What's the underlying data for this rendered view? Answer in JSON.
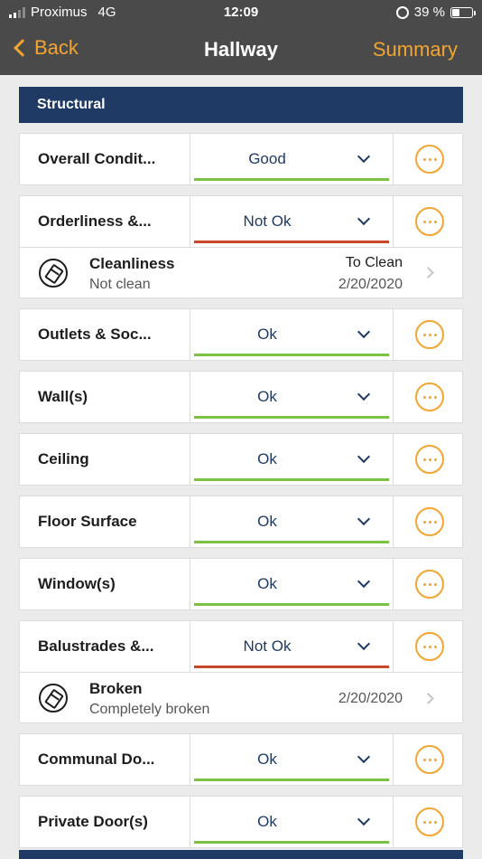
{
  "status_bar": {
    "carrier": "Proximus",
    "network": "4G",
    "time": "12:09",
    "battery": "39 %",
    "battery_level": 0.39
  },
  "nav": {
    "back_label": "Back",
    "title": "Hallway",
    "summary_label": "Summary"
  },
  "colors": {
    "accent": "#f2a531",
    "navy": "#1f3a64",
    "ok_line": "#7bc144",
    "not_ok_line": "#c9482a"
  },
  "section": {
    "title": "Structural"
  },
  "items": [
    {
      "label": "Overall Condit...",
      "value": "Good",
      "status": "ok"
    },
    {
      "label": "Orderliness &...",
      "value": "Not Ok",
      "status": "bad",
      "sub": {
        "name": "Cleanliness",
        "desc": "Not clean",
        "action": "To Clean",
        "date": "2/20/2020"
      }
    },
    {
      "label": "Outlets & Soc...",
      "value": "Ok",
      "status": "ok"
    },
    {
      "label": "Wall(s)",
      "value": "Ok",
      "status": "ok"
    },
    {
      "label": "Ceiling",
      "value": "Ok",
      "status": "ok"
    },
    {
      "label": "Floor Surface",
      "value": "Ok",
      "status": "ok"
    },
    {
      "label": "Window(s)",
      "value": "Ok",
      "status": "ok"
    },
    {
      "label": "Balustrades &...",
      "value": "Not Ok",
      "status": "bad",
      "sub": {
        "name": "Broken",
        "desc": "Completely broken",
        "action": "",
        "date": "2/20/2020"
      }
    },
    {
      "label": "Communal Do...",
      "value": "Ok",
      "status": "ok"
    },
    {
      "label": "Private Door(s)",
      "value": "Ok",
      "status": "ok"
    }
  ]
}
